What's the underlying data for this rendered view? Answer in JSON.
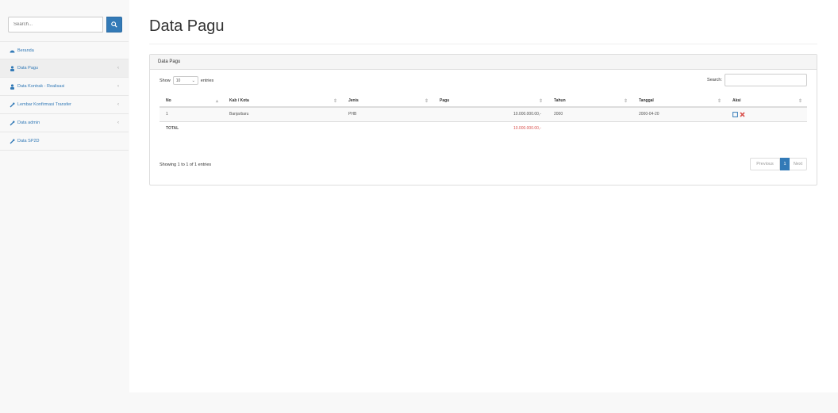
{
  "sidebar": {
    "search_placeholder": "Search...",
    "items": [
      {
        "label": "Beranda",
        "icon": "dashboard-icon",
        "caret": false,
        "active": false
      },
      {
        "label": "Data Pagu",
        "icon": "user-icon",
        "caret": true,
        "active": true
      },
      {
        "label": "Data Kontrak - Realisasi",
        "icon": "user-icon",
        "caret": true,
        "active": false
      },
      {
        "label": "Lembar Konfirmasi Transfer",
        "icon": "wrench-icon",
        "caret": true,
        "active": false
      },
      {
        "label": "Data admin",
        "icon": "wrench-icon",
        "caret": true,
        "active": false
      },
      {
        "label": "Data SP2D",
        "icon": "wrench-icon",
        "caret": false,
        "active": false
      }
    ]
  },
  "page": {
    "title": "Data Pagu",
    "panel_heading": "Data Pagu",
    "show_label": "Show",
    "entries_value": "10",
    "entries_label": "entries",
    "search_label": "Search:",
    "columns": [
      "No",
      "Kab / Kota",
      "Jenis",
      "Pagu",
      "Tahun",
      "Tanggal",
      "Aksi"
    ],
    "rows": [
      {
        "no": "1",
        "kab": "Banjarbaru",
        "jenis": "PHB",
        "pagu": "10.000.000.00,-",
        "tahun": "2000",
        "tanggal": "2000-04-20"
      }
    ],
    "total_label": "TOTAL",
    "total_value": "10.000.000.00,-",
    "info": "Showing 1 to 1 of 1 entries",
    "pager": {
      "prev": "Previous",
      "current": "1",
      "next": "Next"
    }
  },
  "colors": {
    "accent": "#337ab7",
    "danger": "#d9534f"
  }
}
